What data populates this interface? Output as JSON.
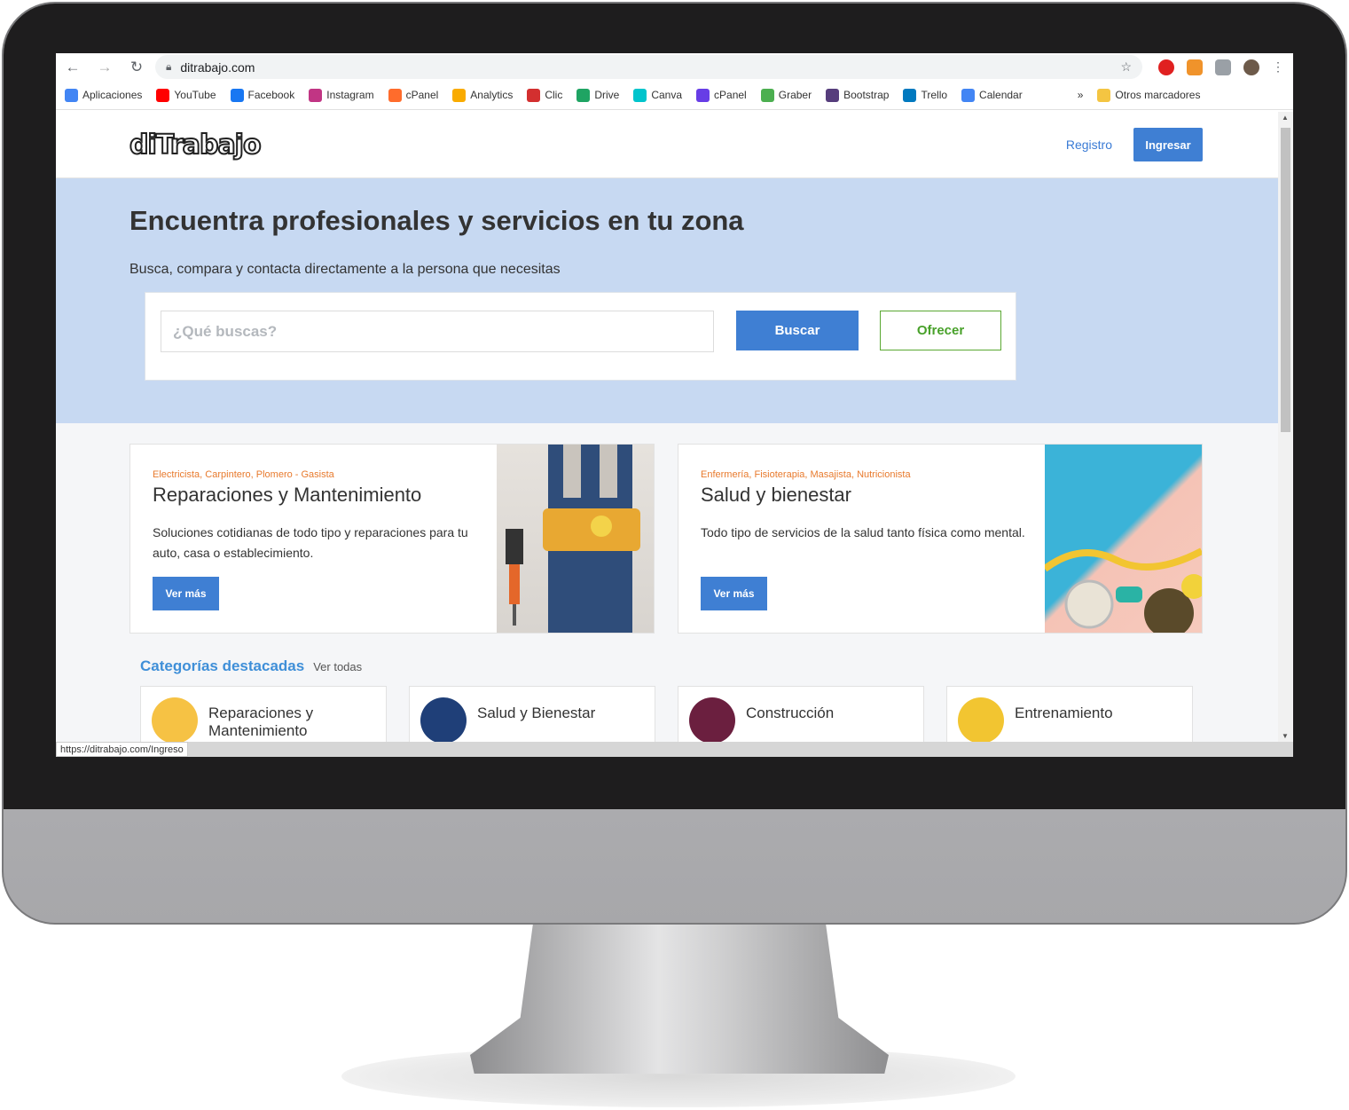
{
  "browser": {
    "url": "ditrabajo.com",
    "status_url": "https://ditrabajo.com/Ingreso",
    "bookmarks": [
      {
        "label": "Aplicaciones",
        "icon": "apps-icon",
        "color": "#4285f4"
      },
      {
        "label": "YouTube",
        "icon": "youtube-icon",
        "color": "#ff0000"
      },
      {
        "label": "Facebook",
        "icon": "facebook-icon",
        "color": "#1877f2"
      },
      {
        "label": "Instagram",
        "icon": "instagram-icon",
        "color": "#c13584"
      },
      {
        "label": "cPanel",
        "icon": "cpanel-icon",
        "color": "#ff6c2c"
      },
      {
        "label": "Analytics",
        "icon": "analytics-icon",
        "color": "#f9ab00"
      },
      {
        "label": "Clic",
        "icon": "clic-icon",
        "color": "#d32f2f"
      },
      {
        "label": "Drive",
        "icon": "drive-icon",
        "color": "#1fa463"
      },
      {
        "label": "Canva",
        "icon": "canva-icon",
        "color": "#00c4cc"
      },
      {
        "label": "cPanel",
        "icon": "hostinger-icon",
        "color": "#673de6"
      },
      {
        "label": "Graber",
        "icon": "graber-icon",
        "color": "#4caf50"
      },
      {
        "label": "Bootstrap",
        "icon": "bootstrap-icon",
        "color": "#563d7c"
      },
      {
        "label": "Trello",
        "icon": "trello-icon",
        "color": "#0079bf"
      },
      {
        "label": "Calendar",
        "icon": "calendar-icon",
        "color": "#4285f4"
      }
    ],
    "more": "»",
    "other_bookmarks": "Otros marcadores"
  },
  "site": {
    "logo": "diTrabajo",
    "registro": "Registro",
    "ingresar": "Ingresar"
  },
  "hero": {
    "title": "Encuentra profesionales y servicios en tu zona",
    "subtitle": "Busca, compara y contacta directamente a la persona que necesitas",
    "search_placeholder": "¿Qué buscas?",
    "buscar": "Buscar",
    "ofrecer": "Ofrecer"
  },
  "cards": [
    {
      "tags": "Electricista, Carpintero, Plomero - Gasista",
      "title": "Reparaciones y Mantenimiento",
      "desc": "Soluciones cotidianas de todo tipo y reparaciones para tu auto, casa o establecimiento.",
      "button": "Ver más"
    },
    {
      "tags": "Enfermería, Fisioterapia, Masajista, Nutricionista",
      "title": "Salud y bienestar",
      "desc": "Todo tipo de servicios de la salud tanto física como mental.",
      "button": "Ver más"
    }
  ],
  "categories": {
    "title": "Categorías destacadas",
    "see_all": "Ver todas",
    "items": [
      {
        "label": "Reparaciones y Mantenimiento",
        "color": "#f6c244"
      },
      {
        "label": "Salud y Bienestar",
        "color": "#1f3f78"
      },
      {
        "label": "Construcción",
        "color": "#6b1f3f"
      },
      {
        "label": "Entrenamiento",
        "color": "#f2c531"
      }
    ]
  },
  "colors": {
    "accent": "#3f7fd3",
    "hero_bg": "#c7d9f2",
    "offer_green": "#48a12a",
    "tag_orange": "#e87a2d"
  }
}
